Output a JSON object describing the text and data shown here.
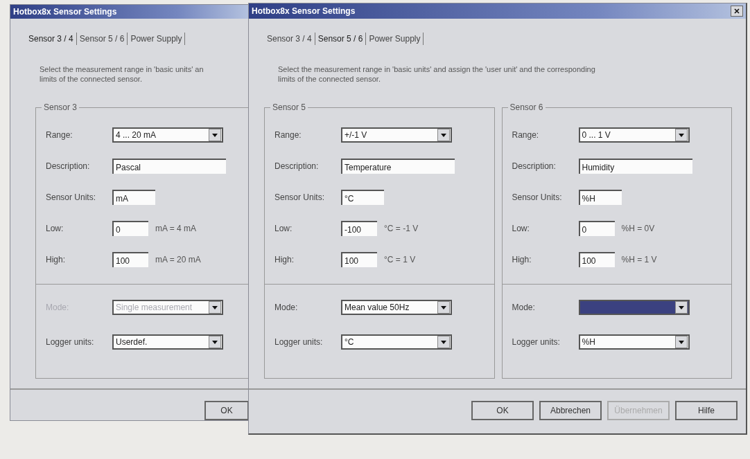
{
  "windows": [
    {
      "title": "Hotbox8x Sensor Settings",
      "front": false,
      "tabs": [
        {
          "label": "Sensor 3 / 4",
          "selected": true
        },
        {
          "label": "Sensor 5 / 6",
          "selected": false
        },
        {
          "label": "Power Supply",
          "selected": false
        }
      ],
      "description": [
        "Select the measurement range in 'basic units' an",
        "limits of the connected sensor."
      ],
      "sensors": [
        {
          "title": "Sensor 3",
          "rows": [
            {
              "kind": "dropdown",
              "label": "Range:",
              "value": "4 ... 20 mA"
            },
            {
              "kind": "text",
              "label": "Description:",
              "value": "Pascal"
            },
            {
              "kind": "unit",
              "label": "Sensor Units:",
              "value": "mA"
            },
            {
              "kind": "limit",
              "label": "Low:",
              "value": "0",
              "note": "mA = 4 mA"
            },
            {
              "kind": "limit",
              "label": "High:",
              "value": "100",
              "note": "mA = 20 mA"
            }
          ],
          "lower_rows": [
            {
              "label": "Mode:",
              "value": "Single measurement",
              "disabled": true,
              "highlighted": false
            },
            {
              "label": "Logger units:",
              "value": "Userdef.",
              "disabled": false,
              "highlighted": false
            }
          ]
        }
      ],
      "buttons": [
        {
          "label": "OK",
          "disabled": false
        }
      ]
    },
    {
      "title": "Hotbox8x Sensor Settings",
      "front": true,
      "tabs": [
        {
          "label": "Sensor 3 / 4",
          "selected": false
        },
        {
          "label": "Sensor 5 / 6",
          "selected": true
        },
        {
          "label": "Power Supply",
          "selected": false
        }
      ],
      "description": [
        "Select the measurement range in 'basic units' and assign the 'user unit' and the corresponding",
        "limits of the connected sensor."
      ],
      "sensors": [
        {
          "title": "Sensor 5",
          "rows": [
            {
              "kind": "dropdown",
              "label": "Range:",
              "value": "+/-1 V"
            },
            {
              "kind": "text",
              "label": "Description:",
              "value": "Temperature"
            },
            {
              "kind": "unit",
              "label": "Sensor Units:",
              "value": "°C"
            },
            {
              "kind": "limit",
              "label": "Low:",
              "value": "-100",
              "note": "°C = -1 V"
            },
            {
              "kind": "limit",
              "label": "High:",
              "value": "100",
              "note": "°C = 1 V"
            }
          ],
          "lower_rows": [
            {
              "label": "Mode:",
              "value": "Mean value 50Hz",
              "disabled": false,
              "highlighted": false
            },
            {
              "label": "Logger units:",
              "value": "°C",
              "disabled": false,
              "highlighted": false
            }
          ]
        },
        {
          "title": "Sensor 6",
          "rows": [
            {
              "kind": "dropdown",
              "label": "Range:",
              "value": "0 ... 1 V"
            },
            {
              "kind": "text",
              "label": "Description:",
              "value": "Humidity"
            },
            {
              "kind": "unit",
              "label": "Sensor Units:",
              "value": "%H"
            },
            {
              "kind": "limit",
              "label": "Low:",
              "value": "0",
              "note": "%H = 0V"
            },
            {
              "kind": "limit",
              "label": "High:",
              "value": "100",
              "note": "%H = 1 V"
            }
          ],
          "lower_rows": [
            {
              "label": "Mode:",
              "disabled": false,
              "highlighted": true
            },
            {
              "label": "Logger units:",
              "value": "%H",
              "disabled": false,
              "highlighted": false
            }
          ]
        }
      ],
      "buttons": [
        {
          "label": "OK",
          "disabled": false
        },
        {
          "label": "Abbrechen",
          "disabled": false
        },
        {
          "label": "Übernehmen",
          "disabled": true
        },
        {
          "label": "Hilfe",
          "disabled": false
        }
      ]
    }
  ]
}
